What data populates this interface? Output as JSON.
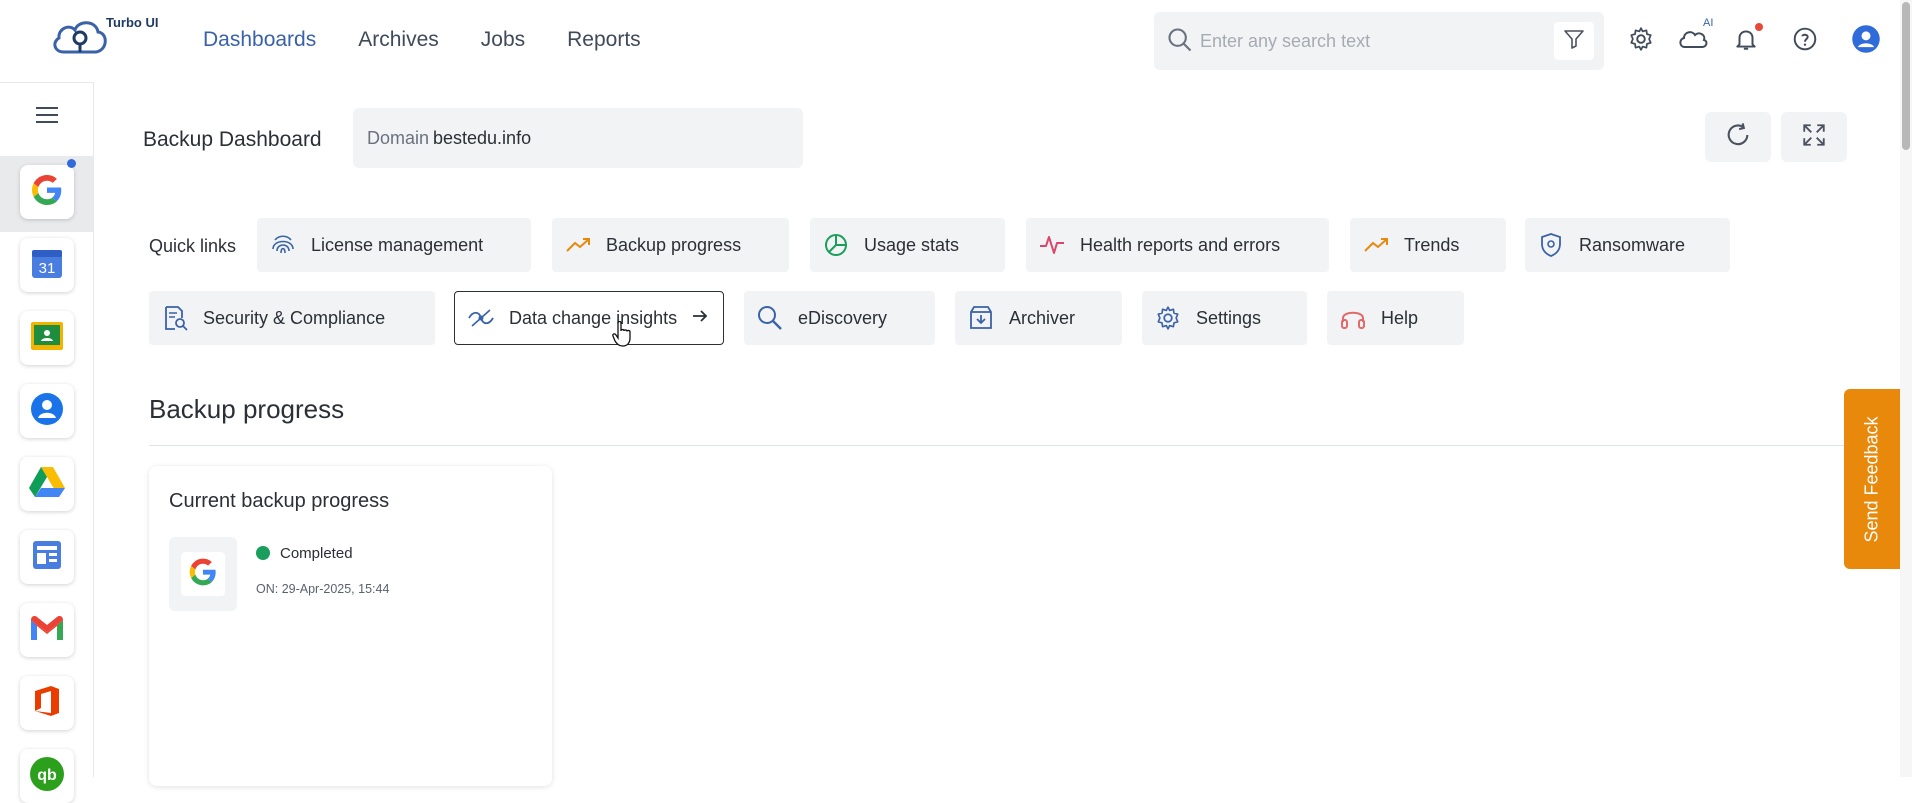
{
  "app": {
    "logo_text": "Turbo UI"
  },
  "nav": {
    "items": [
      {
        "label": "Dashboards",
        "active": true
      },
      {
        "label": "Archives",
        "active": false
      },
      {
        "label": "Jobs",
        "active": false
      },
      {
        "label": "Reports",
        "active": false
      }
    ]
  },
  "search": {
    "placeholder": "Enter any search text",
    "value": ""
  },
  "header_icons": {
    "ai_label": "AI"
  },
  "dashboard": {
    "title": "Backup Dashboard",
    "domain_label": "Domain",
    "domain_value": "bestedu.info"
  },
  "quick_links": {
    "label": "Quick links",
    "row1": [
      {
        "label": "License management",
        "icon": "fingerprint-icon"
      },
      {
        "label": "Backup progress",
        "icon": "trend-up-icon"
      },
      {
        "label": "Usage stats",
        "icon": "pie-chart-icon"
      },
      {
        "label": "Health reports and errors",
        "icon": "pulse-icon"
      },
      {
        "label": "Trends",
        "icon": "trend-up-icon"
      },
      {
        "label": "Ransomware",
        "icon": "shield-icon"
      }
    ],
    "row2": [
      {
        "label": "Security & Compliance",
        "icon": "document-search-icon"
      },
      {
        "label": "Data change insights",
        "icon": "insights-icon"
      },
      {
        "label": "eDiscovery",
        "icon": "magnifier-icon"
      },
      {
        "label": "Archiver",
        "icon": "archive-box-icon"
      },
      {
        "label": "Settings",
        "icon": "gear-icon"
      },
      {
        "label": "Help",
        "icon": "headset-icon"
      }
    ]
  },
  "backup_section": {
    "title": "Backup progress",
    "card": {
      "title": "Current backup progress",
      "status": "Completed",
      "status_color": "#1a9e5c",
      "timestamp": "ON: 29-Apr-2025, 15:44"
    }
  },
  "feedback": {
    "label": "Send Feedback"
  },
  "colors": {
    "accent": "#3a62a8",
    "feedback": "#e8890c",
    "success": "#1a9e5c"
  }
}
